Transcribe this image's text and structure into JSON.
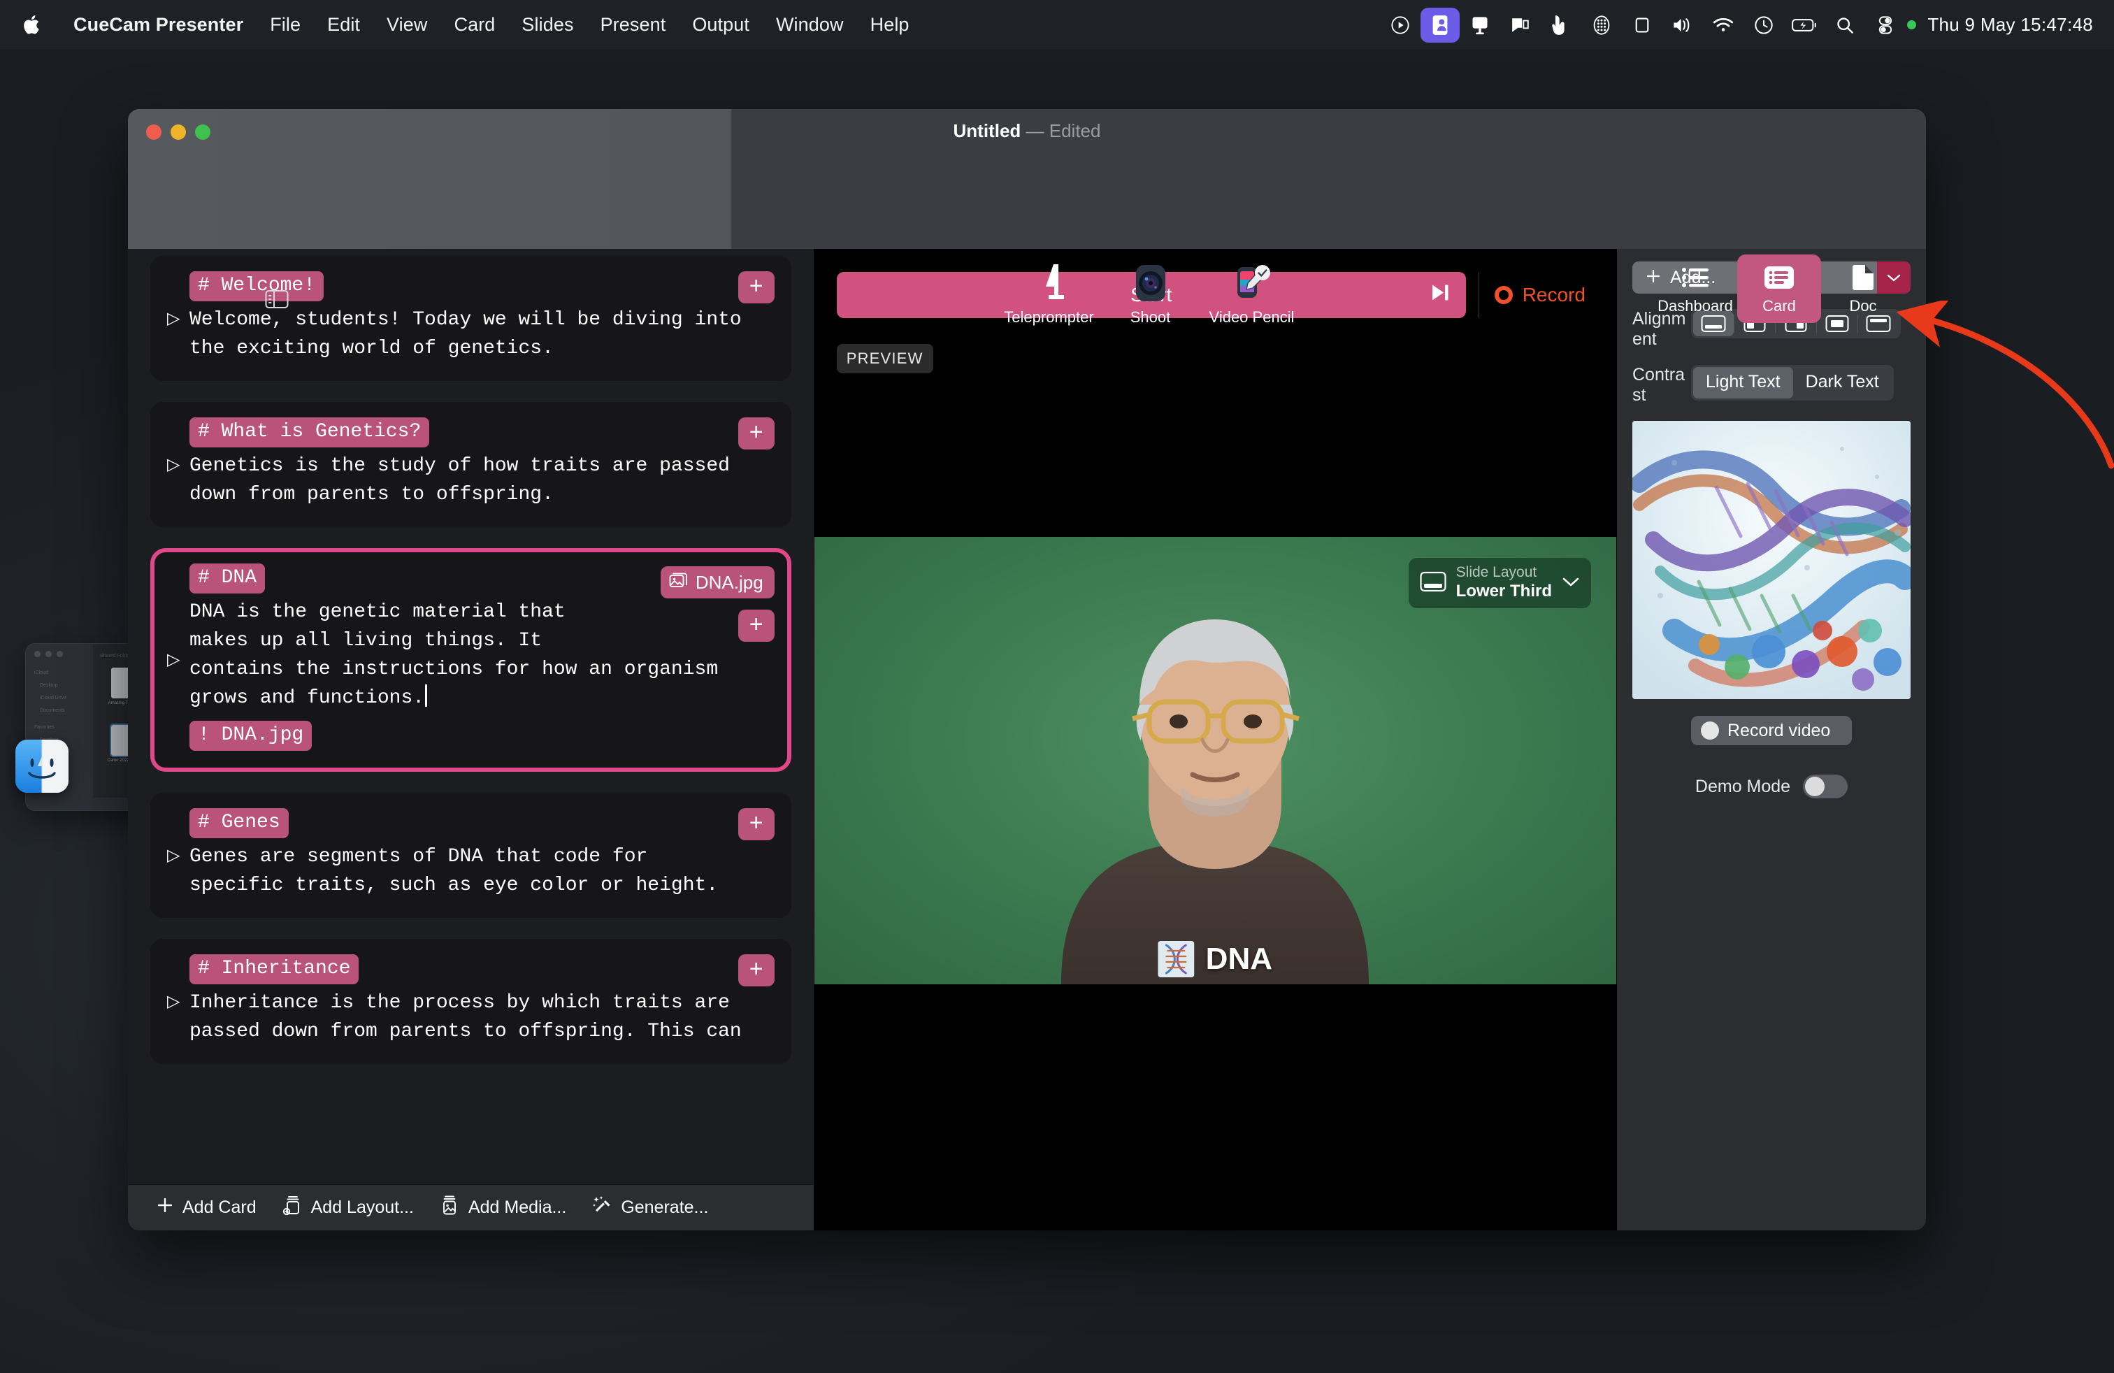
{
  "menubar": {
    "apple_icon": "apple-logo-icon",
    "items": [
      {
        "label": "CueCam Presenter",
        "bold": true
      },
      {
        "label": "File"
      },
      {
        "label": "Edit"
      },
      {
        "label": "View"
      },
      {
        "label": "Card"
      },
      {
        "label": "Slides"
      },
      {
        "label": "Present"
      },
      {
        "label": "Output"
      },
      {
        "label": "Window"
      },
      {
        "label": "Help"
      }
    ],
    "status_icons": [
      "play-circle-icon",
      "screen-share-active-icon",
      "display-icon",
      "airplay-icon",
      "cursor-icon",
      "grid-icon",
      "stage-manager-icon",
      "volume-icon",
      "wifi-icon",
      "control-center-icon",
      "battery-charging-icon",
      "search-icon",
      "toggles-icon"
    ],
    "clock": "Thu 9 May  15:47:48"
  },
  "window": {
    "title": "Untitled",
    "title_dash": "—",
    "title_state": "Edited",
    "sidebar_toggle_icon": "sidebar-toggle-icon",
    "tools": [
      {
        "label": "Teleprompter",
        "icon": "teleprompter-icon"
      },
      {
        "label": "Shoot",
        "icon": "camera-icon"
      },
      {
        "label": "Video Pencil",
        "icon": "video-pencil-icon"
      }
    ],
    "modes": [
      {
        "label": "Dashboard",
        "icon": "list-icon",
        "selected": false
      },
      {
        "label": "Card",
        "icon": "card-list-icon",
        "selected": true
      },
      {
        "label": "Doc",
        "icon": "document-icon",
        "selected": false
      }
    ]
  },
  "cards": [
    {
      "tag": "# Welcome!",
      "body": "Welcome, students! Today we will be diving into\nthe exciting world of genetics.",
      "selected": false,
      "add_label": "+"
    },
    {
      "tag": "# What is Genetics?",
      "body": "Genetics is the study of how traits are passed\ndown from parents to offspring.",
      "selected": false,
      "add_label": "+"
    },
    {
      "tag": "# DNA",
      "body": "DNA is the genetic material that\nmakes up all living things. It\ncontains the instructions for how an organism\ngrows and functions.",
      "media_tag": "! DNA.jpg",
      "media_badge": "DNA.jpg",
      "media_badge_icon": "image-stack-icon",
      "selected": true,
      "add_label": "+"
    },
    {
      "tag": "# Genes",
      "body": "Genes are segments of DNA that code for\nspecific traits, such as eye color or height.",
      "selected": false,
      "add_label": "+"
    },
    {
      "tag": "# Inheritance",
      "body": "Inheritance is the process by which traits are\npassed down from parents to offspring. This can",
      "selected": false,
      "add_label": "+"
    }
  ],
  "bottombar": [
    {
      "label": "Add Card",
      "icon": "plus-icon"
    },
    {
      "label": "Add Layout...",
      "icon": "add-layout-icon"
    },
    {
      "label": "Add Media...",
      "icon": "add-media-icon"
    },
    {
      "label": "Generate...",
      "icon": "sparkle-wand-icon"
    }
  ],
  "preview": {
    "start_label": "Start",
    "skip_icon": "skip-forward-icon",
    "record_label": "Record",
    "record_icon": "record-dot-icon",
    "preview_badge": "PREVIEW",
    "slide_layout": {
      "icon": "lower-third-layout-icon",
      "sub_label": "Slide Layout",
      "value": "Lower Third",
      "chevron": "chevron-down-icon"
    },
    "lower_third_label": "DNA"
  },
  "inspector": {
    "add_label": "Add...",
    "add_plus_icon": "plus-icon",
    "add_caret_icon": "chevron-down-icon",
    "alignment_label": "Alignment",
    "alignment_options": [
      {
        "icon": "align-bottom-bar-icon",
        "selected": true
      },
      {
        "icon": "align-left-half-icon",
        "selected": false
      },
      {
        "icon": "align-right-half-icon",
        "selected": false
      },
      {
        "icon": "align-center-box-icon",
        "selected": false
      },
      {
        "icon": "align-top-bar-icon",
        "selected": false
      }
    ],
    "contrast_label": "Contrast",
    "contrast_options": [
      {
        "label": "Light Text",
        "selected": true
      },
      {
        "label": "Dark Text",
        "selected": false
      }
    ],
    "thumbnail_alt": "dna-helix-thumbnail",
    "record_video_label": "Record video",
    "demo_mode_label": "Demo Mode",
    "demo_mode_on": false
  },
  "annotation": {
    "arrow_color": "#e8391a",
    "points_to": "align-top-bar-icon"
  },
  "colors": {
    "accent_pink": "#d2527f",
    "tag_pink": "#b95478",
    "selection_pink": "#e0488c",
    "record_orange": "#f2502a",
    "menubar_active": "#6b5ce7"
  }
}
